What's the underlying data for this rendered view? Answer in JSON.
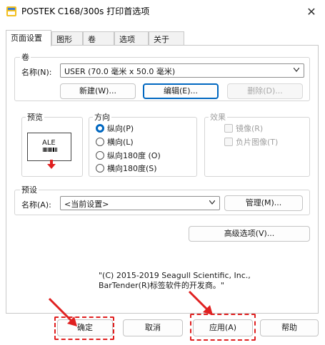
{
  "window": {
    "title": "POSTEK C168/300s 打印首选项",
    "close_glyph": "✕"
  },
  "tabs": [
    {
      "label": "页面设置",
      "active": true
    },
    {
      "label": "图形",
      "active": false
    },
    {
      "label": "卷",
      "active": false
    },
    {
      "label": "选项",
      "active": false
    },
    {
      "label": "关于",
      "active": false
    }
  ],
  "stock": {
    "legend": "卷",
    "name_label": "名称(N):",
    "name_value": "USER (70.0 毫米 x 50.0 毫米)",
    "new_button": "新建(W)...",
    "edit_button": "编辑(E)...",
    "delete_button": "删除(D)..."
  },
  "preview": {
    "legend": "预览",
    "sample_text": "ALE"
  },
  "orientation": {
    "legend": "方向",
    "options": [
      {
        "label": "纵向(P)",
        "checked": true
      },
      {
        "label": "横向(L)",
        "checked": false
      },
      {
        "label": "纵向180度 (O)",
        "checked": false
      },
      {
        "label": "横向180度(S)",
        "checked": false
      }
    ]
  },
  "effects": {
    "legend": "效果",
    "options": [
      {
        "label": "镜像(R)",
        "enabled": false
      },
      {
        "label": "负片图像(T)",
        "enabled": false
      }
    ]
  },
  "preset": {
    "legend": "预设",
    "name_label": "名称(A):",
    "name_value": "<当前设置>",
    "manage_button": "管理(M)..."
  },
  "advanced_button": "高级选项(V)...",
  "copyright": {
    "line1": "\"(C) 2015-2019 Seagull Scientific, Inc.,",
    "line2": "BarTender(R)标签软件的开发商。\""
  },
  "footer": {
    "ok": "确定",
    "cancel": "取消",
    "apply": "应用(A)",
    "help": "帮助"
  },
  "colors": {
    "accent": "#0067c0",
    "annotation": "#e02020"
  },
  "icons": {
    "app": "printer-settings-icon",
    "close": "close-icon",
    "dropdown": "chevron-down-icon",
    "preview_arrow": "arrow-down-icon"
  }
}
